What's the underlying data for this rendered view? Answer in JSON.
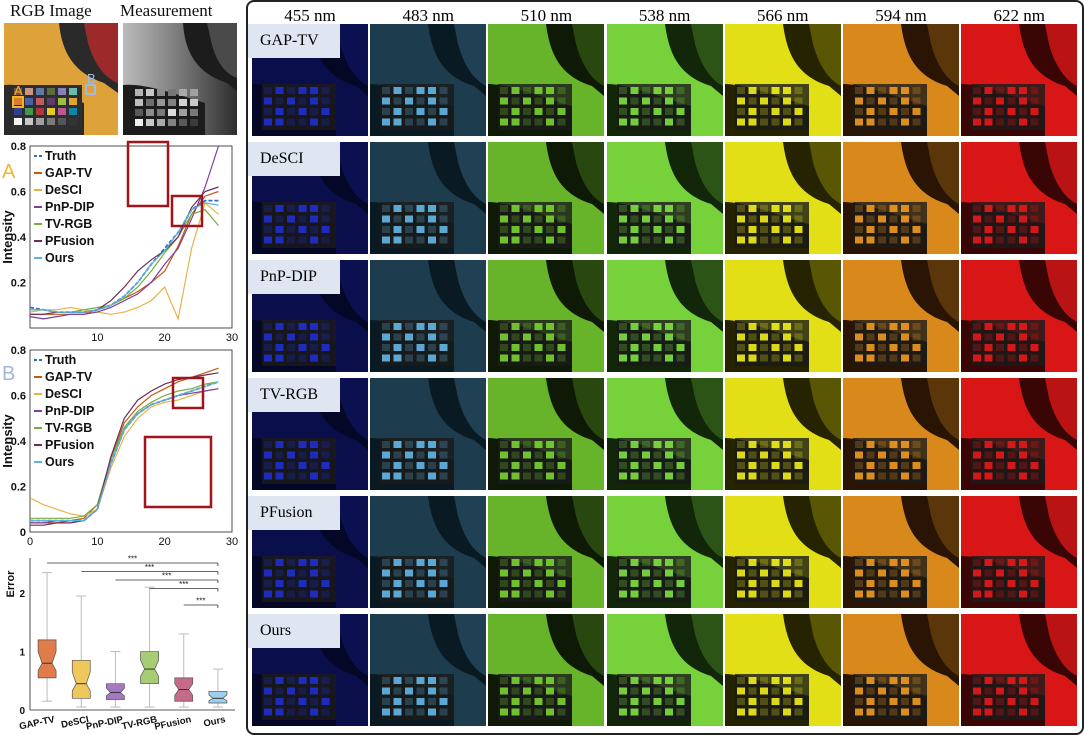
{
  "left": {
    "rgb_label": "RGB Image",
    "meas_label": "Measurement",
    "marker_a": "A",
    "marker_b": "B"
  },
  "chart_data": [
    {
      "type": "line",
      "panel_letter": "A",
      "ylabel": "Intensity",
      "xlim": [
        0,
        30
      ],
      "ylim": [
        0,
        0.8
      ],
      "xticks": [
        10,
        20,
        30
      ],
      "yticks": [
        0.2,
        0.4,
        0.6,
        0.8
      ],
      "legend_placement": "top-left",
      "x": [
        0,
        2,
        4,
        6,
        8,
        10,
        12,
        14,
        16,
        18,
        20,
        22,
        24,
        26,
        28
      ],
      "series": [
        {
          "name": "Truth",
          "color": "#2f6fb8",
          "dash": true,
          "values": [
            0.09,
            0.08,
            0.07,
            0.07,
            0.07,
            0.08,
            0.1,
            0.14,
            0.2,
            0.28,
            0.35,
            0.42,
            0.52,
            0.56,
            0.56
          ]
        },
        {
          "name": "GAP-TV",
          "color": "#c55a11",
          "values": [
            0.06,
            0.06,
            0.06,
            0.06,
            0.06,
            0.08,
            0.1,
            0.13,
            0.16,
            0.2,
            0.25,
            0.36,
            0.5,
            0.58,
            0.6
          ]
        },
        {
          "name": "DeSCI",
          "color": "#e6b34a",
          "values": [
            0.07,
            0.08,
            0.08,
            0.09,
            0.08,
            0.07,
            0.06,
            0.07,
            0.09,
            0.12,
            0.18,
            0.04,
            0.35,
            0.55,
            0.5
          ]
        },
        {
          "name": "PnP-DIP",
          "color": "#7b3f9e",
          "values": [
            0.05,
            0.04,
            0.05,
            0.06,
            0.06,
            0.07,
            0.09,
            0.12,
            0.15,
            0.2,
            0.28,
            0.35,
            0.48,
            0.62,
            0.8
          ]
        },
        {
          "name": "TV-RGB",
          "color": "#77ac3c",
          "values": [
            0.08,
            0.08,
            0.07,
            0.07,
            0.08,
            0.09,
            0.1,
            0.13,
            0.18,
            0.25,
            0.33,
            0.4,
            0.5,
            0.52,
            0.45
          ]
        },
        {
          "name": "PFusion",
          "color": "#6f2a5a",
          "values": [
            0.06,
            0.06,
            0.07,
            0.07,
            0.07,
            0.08,
            0.12,
            0.18,
            0.25,
            0.3,
            0.34,
            0.4,
            0.53,
            0.6,
            0.62
          ]
        },
        {
          "name": "Ours",
          "color": "#5bb4e0",
          "values": [
            0.08,
            0.08,
            0.07,
            0.07,
            0.07,
            0.08,
            0.1,
            0.14,
            0.2,
            0.28,
            0.34,
            0.42,
            0.52,
            0.55,
            0.54
          ]
        }
      ]
    },
    {
      "type": "line",
      "panel_letter": "B",
      "ylabel": "Intensity",
      "xlim": [
        0,
        30
      ],
      "ylim": [
        0,
        0.8
      ],
      "xticks": [
        0,
        10,
        20,
        30
      ],
      "yticks": [
        0,
        0.2,
        0.4,
        0.6,
        0.8
      ],
      "legend_placement": "top-left",
      "x": [
        0,
        2,
        4,
        6,
        8,
        10,
        12,
        14,
        16,
        18,
        20,
        22,
        24,
        26,
        28
      ],
      "series": [
        {
          "name": "Truth",
          "color": "#2f6fb8",
          "dash": true,
          "values": [
            0.05,
            0.05,
            0.05,
            0.05,
            0.05,
            0.1,
            0.3,
            0.45,
            0.52,
            0.56,
            0.58,
            0.6,
            0.62,
            0.64,
            0.66
          ]
        },
        {
          "name": "GAP-TV",
          "color": "#c55a11",
          "values": [
            0.04,
            0.04,
            0.04,
            0.05,
            0.06,
            0.12,
            0.32,
            0.48,
            0.55,
            0.6,
            0.63,
            0.66,
            0.68,
            0.7,
            0.72
          ]
        },
        {
          "name": "DeSCI",
          "color": "#e6b34a",
          "values": [
            0.15,
            0.12,
            0.1,
            0.08,
            0.07,
            0.1,
            0.28,
            0.42,
            0.5,
            0.55,
            0.57,
            0.58,
            0.6,
            0.62,
            0.63
          ]
        },
        {
          "name": "PnP-DIP",
          "color": "#7b3f9e",
          "values": [
            0.04,
            0.04,
            0.05,
            0.05,
            0.05,
            0.1,
            0.3,
            0.45,
            0.52,
            0.56,
            0.58,
            0.6,
            0.61,
            0.62,
            0.63
          ]
        },
        {
          "name": "TV-RGB",
          "color": "#77ac3c",
          "values": [
            0.06,
            0.06,
            0.06,
            0.06,
            0.07,
            0.12,
            0.32,
            0.46,
            0.53,
            0.57,
            0.6,
            0.62,
            0.63,
            0.65,
            0.66
          ]
        },
        {
          "name": "PFusion",
          "color": "#6f2a5a",
          "values": [
            0.03,
            0.03,
            0.04,
            0.04,
            0.05,
            0.1,
            0.33,
            0.5,
            0.58,
            0.62,
            0.65,
            0.67,
            0.68,
            0.69,
            0.7
          ]
        },
        {
          "name": "Ours",
          "color": "#5bb4e0",
          "values": [
            0.05,
            0.05,
            0.05,
            0.05,
            0.05,
            0.1,
            0.3,
            0.45,
            0.52,
            0.56,
            0.58,
            0.6,
            0.62,
            0.64,
            0.66
          ]
        }
      ]
    },
    {
      "type": "box",
      "ylabel": "Error",
      "ylim": [
        0,
        2.6
      ],
      "yticks": [
        0,
        1,
        2
      ],
      "significance": "***",
      "categories": [
        "GAP-TV",
        "DeSCI",
        "PnP-DIP",
        "TV-RGB",
        "PFusion",
        "Ours"
      ],
      "colors": [
        "#e07b4a",
        "#f0c75a",
        "#a678c2",
        "#a7cc74",
        "#c56b8a",
        "#9cd0ec"
      ],
      "boxes": [
        {
          "min": 0.15,
          "q1": 0.55,
          "median": 0.8,
          "q3": 1.2,
          "max": 2.35
        },
        {
          "min": 0.05,
          "q1": 0.2,
          "median": 0.45,
          "q3": 0.85,
          "max": 1.95
        },
        {
          "min": 0.05,
          "q1": 0.18,
          "median": 0.3,
          "q3": 0.45,
          "max": 1.0
        },
        {
          "min": 0.05,
          "q1": 0.45,
          "median": 0.7,
          "q3": 1.0,
          "max": 2.1
        },
        {
          "min": 0.05,
          "q1": 0.15,
          "median": 0.35,
          "q3": 0.55,
          "max": 1.3
        },
        {
          "min": 0.05,
          "q1": 0.12,
          "median": 0.2,
          "q3": 0.32,
          "max": 0.7
        }
      ]
    }
  ],
  "grid": {
    "wavelengths": [
      "455 nm",
      "483 nm",
      "510 nm",
      "538 nm",
      "566 nm",
      "594 nm",
      "622 nm"
    ],
    "methods": [
      "GAP-TV",
      "DeSCI",
      "PnP-DIP",
      "TV-RGB",
      "PFusion",
      "Ours"
    ],
    "band_colors": [
      "#1f2fd0",
      "#62b8e8",
      "#7ad430",
      "#80e040",
      "#f2f018",
      "#f29a20",
      "#e61818"
    ],
    "band_bg": [
      "#050726",
      "#0a1a22",
      "#0e1a06",
      "#12260a",
      "#262400",
      "#2a1504",
      "#3a0505"
    ]
  }
}
